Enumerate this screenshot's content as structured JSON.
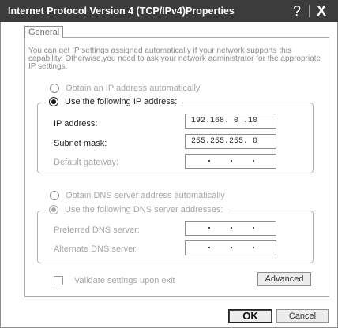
{
  "window": {
    "title": "Internet Protocol Version 4 (TCP/IPv4)Properties",
    "help_glyph": "?",
    "close_glyph": "X"
  },
  "tab": {
    "label": "General"
  },
  "intro": "You can get IP settings assigned automatically if your network supports this capability. Otherwise,you need to ask your network administrator for the appropriate IP settings.",
  "ip_section": {
    "obtain_auto_label": "Obtain an IP address automatically",
    "use_following_label": "Use the following IP address:",
    "selected": "use_following",
    "ip_address_label": "IP address:",
    "ip_address_value": "192.168. 0 .10",
    "subnet_mask_label": "Subnet mask:",
    "subnet_mask_value": "255.255.255. 0",
    "default_gateway_label": "Default gateway:",
    "default_gateway_value": ""
  },
  "dns_section": {
    "obtain_auto_label": "Obtain DNS server address automatically",
    "use_following_label": "Use the following DNS server addresses:",
    "selected": "use_following",
    "preferred_label": "Preferred DNS server:",
    "preferred_value": "",
    "alternate_label": "Alternate DNS server:",
    "alternate_value": ""
  },
  "validate": {
    "label": "Validate settings upon exit",
    "checked": false
  },
  "buttons": {
    "advanced": "Advanced",
    "ok": "OK",
    "cancel": "Cancel"
  },
  "colors": {
    "titlebar": "#3c3c3c",
    "title_text": "#ffffff",
    "disabled_text": "#a6a6a6"
  }
}
